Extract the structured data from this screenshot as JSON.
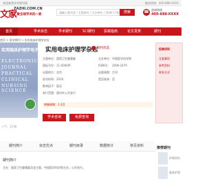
{
  "topbar": {
    "left": "欢迎来到学术期刊网",
    "right": "服务热线：400-888-XXXX"
  },
  "header": {
    "logo_mark": "文家",
    "logo_url": "ZAZHI.COM.CN",
    "logo_slogan": "汇聚全球学术的一家",
    "search_placeholder": "请输入期刊名 / 主管单位 / 主办单位 / ISSN / CN号",
    "search_button": "搜索",
    "phone_label": "咨询热线",
    "phone_number": "400-888-XXXX"
  },
  "nav": [
    "首页",
    "学术杂志",
    "学术期刊",
    "SCI期刊",
    "投稿指南",
    "论文发表",
    "期刊"
  ],
  "breadcrumb": "首页 > 医学期刊 > 实用电床护理学杂志",
  "cover": {
    "cn_title": "实用临床护理学电子杂志",
    "en_lines": [
      "ELECTRONIC",
      "JOURNAL",
      "PRACTICAL",
      "CLINICAL",
      "NURSING SCIENCE"
    ],
    "stats": "人气：1238"
  },
  "journal": {
    "title": "实用电床护理学杂志",
    "badge": "期刊优选",
    "rows": [
      {
        "l": "主管单位：",
        "v": "国家卫生健康委",
        "l2": "主办单位：",
        "v2": "中国医学科学院"
      },
      {
        "l": "国际刊号：",
        "v": "11-0000/R",
        "l2": "ISSN号：",
        "v2": "2096-2479"
      },
      {
        "l": "出版地方：",
        "v": "北京",
        "l2": "出版周期：",
        "v2": "月刊"
      },
      {
        "l": "创刊时间：",
        "v": "2016",
        "l2": "是否收录：",
        "v2": "否"
      }
    ],
    "extra1": "影响因子：暂无",
    "extra2": "发行范围：国内外公开发行",
    "pubcycle": "审稿周期：1-3月",
    "consult": "学术咨询",
    "free_check": "免费查询"
  },
  "right_panel": {
    "title": "投稿须知",
    "lines": [
      "注意事项",
      "参考资料",
      "联系方式"
    ]
  },
  "tabs": [
    "期刊简介",
    "杂志优点",
    "期刊目录",
    "数据统计",
    "常见资料"
  ],
  "section": {
    "title": "期刊简介",
    "line": "主办：国家卫生健康委员会主管，中国医学科学院主办，公开发行。"
  },
  "side": {
    "head": "推荐期刊",
    "items": [
      "护理研究",
      "临床护理"
    ]
  }
}
